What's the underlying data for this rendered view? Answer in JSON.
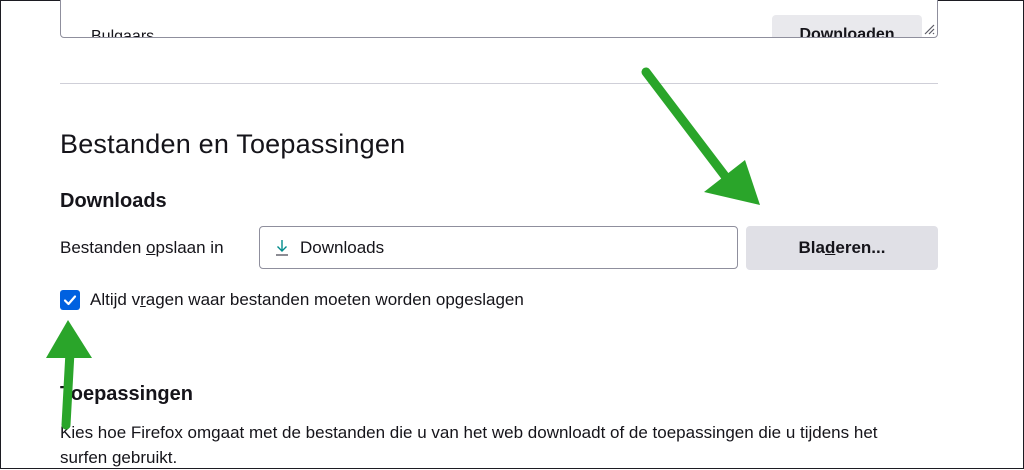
{
  "languages": {
    "partial_item": "Bulgaars",
    "download_button": "Downloaden"
  },
  "section": {
    "title": "Bestanden en Toepassingen"
  },
  "downloads": {
    "title": "Downloads",
    "save_label_before": "Bestanden ",
    "save_label_accesskey": "o",
    "save_label_after": "pslaan in",
    "folder_value": "Downloads",
    "browse_before": "Bla",
    "browse_accesskey": "d",
    "browse_after": "eren...",
    "always_ask_before": "Altijd v",
    "always_ask_accesskey": "r",
    "always_ask_after": "agen waar bestanden moeten worden opgeslagen",
    "always_ask_checked": true
  },
  "applications": {
    "title": "Toepassingen",
    "description": "Kies hoe Firefox omgaat met de bestanden die u van het web downloadt of de toepassingen die u tijdens het surfen gebruikt."
  },
  "colors": {
    "accent": "#0061e0",
    "annotation_arrow": "#2aa52a"
  },
  "icons": {
    "folder_icon": "download-arrow-icon",
    "check_icon": "checkmark-icon"
  }
}
